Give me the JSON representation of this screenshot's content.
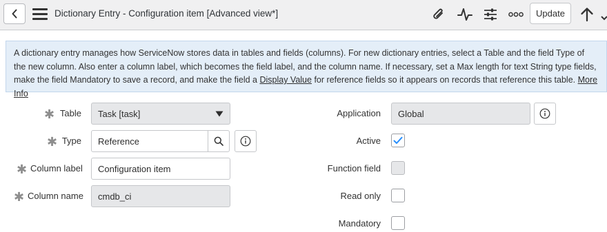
{
  "header": {
    "title": "Dictionary Entry - Configuration item [Advanced view*]",
    "update_label": "Update"
  },
  "info": {
    "text_before_link": "A dictionary entry manages how ServiceNow stores data in tables and fields (columns). For new dictionary entries, select a Table and the field Type of the new column. Also enter a column label, which becomes the field label, and the column name. If necessary, set a Max length for text String type fields, make the field Mandatory to save a record, and make the field a ",
    "display_value_link": "Display Value",
    "text_after_link": " for reference fields so it appears on records that reference this table.",
    "more_info_link": "More Info"
  },
  "form": {
    "table": {
      "label": "Table",
      "value": "Task [task]"
    },
    "type": {
      "label": "Type",
      "value": "Reference"
    },
    "column_label": {
      "label": "Column label",
      "value": "Configuration item"
    },
    "column_name": {
      "label": "Column name",
      "value": "cmdb_ci"
    },
    "application": {
      "label": "Application",
      "value": "Global"
    },
    "active": {
      "label": "Active",
      "checked": true
    },
    "function_field": {
      "label": "Function field",
      "checked": false
    },
    "read_only": {
      "label": "Read only",
      "checked": false
    },
    "mandatory": {
      "label": "Mandatory",
      "checked": false
    }
  },
  "colors": {
    "header_bg": "#f0f0f1",
    "info_bg": "#e4eef8",
    "check_accent": "#278efc",
    "readonly_bg": "#e6e7e9"
  },
  "icons": [
    "chevron-left-icon",
    "menu-icon",
    "paperclip-icon",
    "activity-icon",
    "sliders-icon",
    "more-icon",
    "arrow-up-icon",
    "chevron-down-icon",
    "dropdown-arrow-icon",
    "search-icon",
    "info-icon",
    "checkmark-icon",
    "required-asterisk-icon"
  ]
}
